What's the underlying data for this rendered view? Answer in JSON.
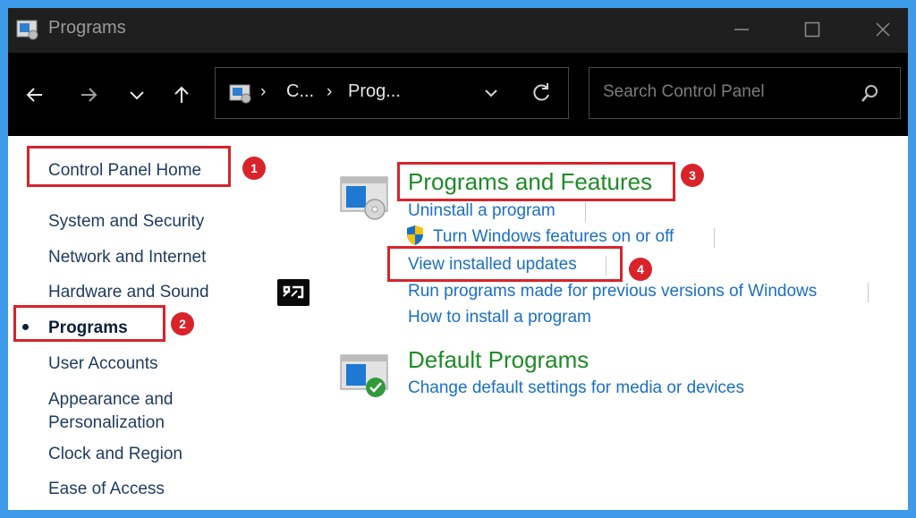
{
  "window": {
    "title": "Programs",
    "controls": {
      "minimize": "minimize",
      "maximize": "maximize",
      "close": "close"
    }
  },
  "nav": {
    "back": "back-arrow",
    "forward": "forward-arrow",
    "recent": "chevron-down",
    "up": "up-arrow"
  },
  "address": {
    "crumbs": [
      "C...",
      "Prog..."
    ],
    "separator": "›"
  },
  "search": {
    "placeholder": "Search Control Panel"
  },
  "sidebar": {
    "home": "Control Panel Home",
    "items": [
      {
        "label": "System and Security"
      },
      {
        "label": "Network and Internet"
      },
      {
        "label": "Hardware and Sound"
      },
      {
        "label": "Programs",
        "current": true
      },
      {
        "label": "User Accounts"
      },
      {
        "label": "Appearance and"
      },
      {
        "label": "Personalization"
      },
      {
        "label": "Clock and Region"
      },
      {
        "label": "Ease of Access"
      }
    ]
  },
  "main": {
    "programs_features": {
      "title": "Programs and Features",
      "tasks": [
        "Uninstall a program",
        "Turn Windows features on or off",
        "View installed updates",
        "Run programs made for previous versions of Windows",
        "How to install a program"
      ]
    },
    "default_programs": {
      "title": "Default Programs",
      "tasks": [
        "Change default settings for media or devices"
      ]
    }
  },
  "annotations": {
    "badges": [
      "1",
      "2",
      "3",
      "4"
    ],
    "color": "#d8232a"
  },
  "colors": {
    "category_title": "#1e8a27",
    "task_link": "#1a6fc4",
    "frame": "#3d9be9"
  }
}
